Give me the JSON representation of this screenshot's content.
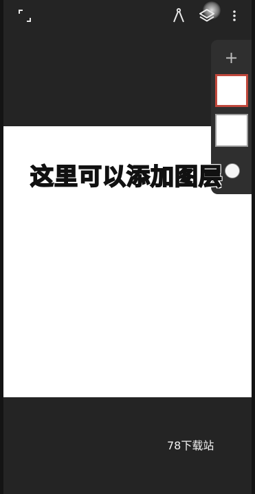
{
  "toolbar": {
    "icons": [
      "fullscreen-icon",
      "ruler-compass-icon",
      "layers-icon",
      "more-vertical-icon"
    ]
  },
  "layers_panel": {
    "add_label": "+",
    "selected_layer_border_color": "#c0483c",
    "layer_count": 2
  },
  "canvas": {
    "background_color": "#ffffff"
  },
  "overlay": {
    "hint_text": "这里可以添加图层"
  },
  "watermark": {
    "text": "78下载站"
  }
}
